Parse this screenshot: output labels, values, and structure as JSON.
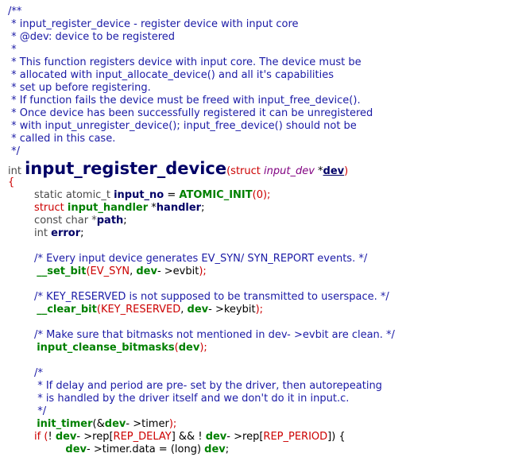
{
  "lines": [
    {
      "tokens": [
        {
          "t": "/**",
          "c": "c"
        }
      ]
    },
    {
      "tokens": [
        {
          "t": " * input_register_device - register device with input core",
          "c": "c"
        }
      ]
    },
    {
      "tokens": [
        {
          "t": " * @dev: device to be registered",
          "c": "c"
        }
      ]
    },
    {
      "tokens": [
        {
          "t": " *",
          "c": "c"
        }
      ]
    },
    {
      "tokens": [
        {
          "t": " * This function registers device with input core. The device must be",
          "c": "c"
        }
      ]
    },
    {
      "tokens": [
        {
          "t": " * allocated with input_allocate_device() and all it's capabilities",
          "c": "c"
        }
      ]
    },
    {
      "tokens": [
        {
          "t": " * set up before registering.",
          "c": "c"
        }
      ]
    },
    {
      "tokens": [
        {
          "t": " * If function fails the device must be freed with input_free_device().",
          "c": "c"
        }
      ]
    },
    {
      "tokens": [
        {
          "t": " * Once device has been successfully registered it can be unregistered",
          "c": "c"
        }
      ]
    },
    {
      "tokens": [
        {
          "t": " * with input_unregister_device(); input_free_device() should not be",
          "c": "c"
        }
      ]
    },
    {
      "tokens": [
        {
          "t": " * called in this case.",
          "c": "c"
        }
      ]
    },
    {
      "tokens": [
        {
          "t": " */",
          "c": "c"
        }
      ]
    },
    {
      "big": true,
      "tokens": [
        {
          "t": "int ",
          "c": "ty"
        },
        {
          "t": "input_register_device",
          "c": "fnbig"
        },
        {
          "t": "(",
          "c": "pr"
        },
        {
          "t": "struct ",
          "c": "kw"
        },
        {
          "t": "input_dev",
          "c": "dt"
        },
        {
          "t": " *",
          "c": "pl"
        },
        {
          "t": "dev",
          "c": "pm"
        },
        {
          "t": ")",
          "c": "pr"
        }
      ]
    },
    {
      "tokens": [
        {
          "t": "{",
          "c": "pr"
        }
      ]
    },
    {
      "tokens": [
        {
          "t": "        static atomic_t ",
          "c": "ty"
        },
        {
          "t": "input_no",
          "c": "vr"
        },
        {
          "t": " = ",
          "c": "op"
        },
        {
          "t": "ATOMIC_INIT",
          "c": "mac"
        },
        {
          "t": "(",
          "c": "pr"
        },
        {
          "t": "0",
          "c": "cn"
        },
        {
          "t": ");",
          "c": "pr"
        }
      ]
    },
    {
      "tokens": [
        {
          "t": "        struct ",
          "c": "kw"
        },
        {
          "t": "input_handler",
          "c": "fnc"
        },
        {
          "t": " *",
          "c": "pl"
        },
        {
          "t": "handler",
          "c": "vr"
        },
        {
          "t": ";",
          "c": "pl"
        }
      ]
    },
    {
      "tokens": [
        {
          "t": "        const char *",
          "c": "ty"
        },
        {
          "t": "path",
          "c": "vr"
        },
        {
          "t": ";",
          "c": "pl"
        }
      ]
    },
    {
      "tokens": [
        {
          "t": "        int ",
          "c": "ty"
        },
        {
          "t": "error",
          "c": "vr"
        },
        {
          "t": ";",
          "c": "pl"
        }
      ]
    },
    {
      "tokens": [
        {
          "t": " ",
          "c": "pl"
        }
      ]
    },
    {
      "tokens": [
        {
          "t": "        /* Every input device generates EV_SYN/ SYN_REPORT events. */",
          "c": "c"
        }
      ]
    },
    {
      "tokens": [
        {
          "t": "        __set_bit",
          "c": "fnc"
        },
        {
          "t": "(",
          "c": "pr"
        },
        {
          "t": "EV_SYN",
          "c": "cn"
        },
        {
          "t": ", ",
          "c": "pl"
        },
        {
          "t": "dev",
          "c": "fnc"
        },
        {
          "t": "- >evbit",
          "c": "pl"
        },
        {
          "t": ");",
          "c": "pr"
        }
      ]
    },
    {
      "tokens": [
        {
          "t": " ",
          "c": "pl"
        }
      ]
    },
    {
      "tokens": [
        {
          "t": "        /* KEY_RESERVED is not supposed to be transmitted to userspace. */",
          "c": "c"
        }
      ]
    },
    {
      "tokens": [
        {
          "t": "        __clear_bit",
          "c": "fnc"
        },
        {
          "t": "(",
          "c": "pr"
        },
        {
          "t": "KEY_RESERVED",
          "c": "cn"
        },
        {
          "t": ", ",
          "c": "pl"
        },
        {
          "t": "dev",
          "c": "fnc"
        },
        {
          "t": "- >keybit",
          "c": "pl"
        },
        {
          "t": ");",
          "c": "pr"
        }
      ]
    },
    {
      "tokens": [
        {
          "t": " ",
          "c": "pl"
        }
      ]
    },
    {
      "tokens": [
        {
          "t": "        /* Make sure that bitmasks not mentioned in dev- >evbit are clean. */",
          "c": "c"
        }
      ]
    },
    {
      "tokens": [
        {
          "t": "        input_cleanse_bitmasks",
          "c": "fnc"
        },
        {
          "t": "(",
          "c": "pr"
        },
        {
          "t": "dev",
          "c": "fnc"
        },
        {
          "t": ");",
          "c": "pr"
        }
      ]
    },
    {
      "tokens": [
        {
          "t": " ",
          "c": "pl"
        }
      ]
    },
    {
      "tokens": [
        {
          "t": "        /*",
          "c": "c"
        }
      ]
    },
    {
      "tokens": [
        {
          "t": "         * If delay and period are pre- set by the driver, then autorepeating",
          "c": "c"
        }
      ]
    },
    {
      "tokens": [
        {
          "t": "         * is handled by the driver itself and we don't do it in input.c.",
          "c": "c"
        }
      ]
    },
    {
      "tokens": [
        {
          "t": "         */",
          "c": "c"
        }
      ]
    },
    {
      "tokens": [
        {
          "t": "        init_timer",
          "c": "fnc"
        },
        {
          "t": "(&",
          "c": "pl"
        },
        {
          "t": "dev",
          "c": "fnc"
        },
        {
          "t": "- >timer",
          "c": "pl"
        },
        {
          "t": ");",
          "c": "pr"
        }
      ]
    },
    {
      "tokens": [
        {
          "t": "        if ",
          "c": "kw"
        },
        {
          "t": "(",
          "c": "pr"
        },
        {
          "t": "! ",
          "c": "pl"
        },
        {
          "t": "dev",
          "c": "fnc"
        },
        {
          "t": "- >rep[",
          "c": "pl"
        },
        {
          "t": "REP_DELAY",
          "c": "cn"
        },
        {
          "t": "] && ! ",
          "c": "pl"
        },
        {
          "t": "dev",
          "c": "fnc"
        },
        {
          "t": "- >rep[",
          "c": "pl"
        },
        {
          "t": "REP_PERIOD",
          "c": "cn"
        },
        {
          "t": "]) {",
          "c": "pl"
        }
      ]
    },
    {
      "tokens": [
        {
          "t": "                dev",
          "c": "fnc"
        },
        {
          "t": "- >timer.data = (long) ",
          "c": "pl"
        },
        {
          "t": "dev",
          "c": "fnc"
        },
        {
          "t": ";",
          "c": "pl"
        }
      ]
    }
  ]
}
